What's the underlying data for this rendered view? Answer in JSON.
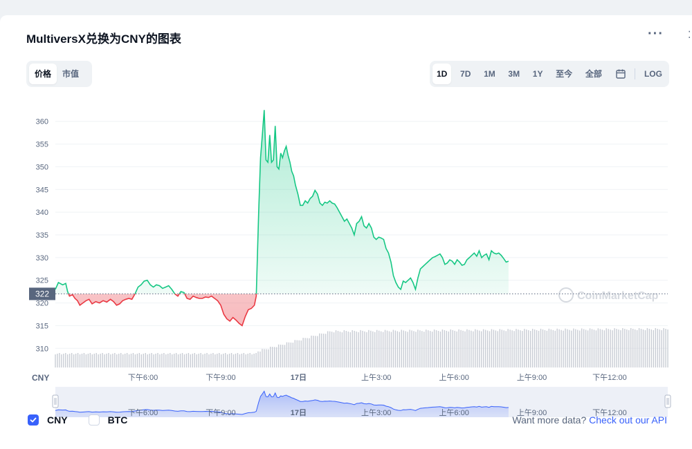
{
  "title": "MultiversX兑换为CNY的图表",
  "menu_icon": "more-dots-icon",
  "view_toggle": [
    "价格",
    "市值"
  ],
  "view_active": 0,
  "ranges": [
    "1D",
    "7D",
    "1M",
    "3M",
    "1Y",
    "至今",
    "全部"
  ],
  "range_active": 0,
  "calendar_icon": "calendar-icon",
  "log_label": "LOG",
  "legend": {
    "cny": "CNY",
    "btc": "BTC"
  },
  "api": {
    "prefix": "Want more data?",
    "link": "Check out our API"
  },
  "watermark": "CoinMarketCap",
  "colors": {
    "up": "#16c784",
    "down": "#ea3943",
    "accent": "#3861fb",
    "grid": "#eff2f5",
    "axis_text": "#58667e"
  },
  "chart_data": {
    "type": "line",
    "currency_label": "CNY",
    "baseline": 322,
    "ylim": [
      307,
      363
    ],
    "yticks": [
      310,
      315,
      320,
      325,
      330,
      335,
      340,
      345,
      350,
      355,
      360
    ],
    "x_ticks": [
      {
        "label": "下午6:00",
        "t": 0.143
      },
      {
        "label": "下午9:00",
        "t": 0.27
      },
      {
        "label": "17日",
        "t": 0.397
      },
      {
        "label": "上午3:00",
        "t": 0.524
      },
      {
        "label": "上午6:00",
        "t": 0.651
      },
      {
        "label": "上午9:00",
        "t": 0.778
      },
      {
        "label": "下午12:00",
        "t": 0.905
      }
    ],
    "series": [
      {
        "points": [
          [
            0.0,
            323.0
          ],
          [
            0.005,
            324.5
          ],
          [
            0.012,
            324.0
          ],
          [
            0.017,
            324.3
          ],
          [
            0.02,
            322.5
          ],
          [
            0.023,
            321.5
          ],
          [
            0.028,
            321.8
          ],
          [
            0.032,
            321.0
          ],
          [
            0.036,
            320.5
          ],
          [
            0.04,
            319.5
          ],
          [
            0.045,
            320.0
          ],
          [
            0.05,
            320.5
          ],
          [
            0.055,
            320.8
          ],
          [
            0.06,
            319.8
          ],
          [
            0.066,
            320.3
          ],
          [
            0.072,
            320.0
          ],
          [
            0.078,
            320.5
          ],
          [
            0.084,
            320.2
          ],
          [
            0.09,
            320.8
          ],
          [
            0.095,
            320.3
          ],
          [
            0.1,
            319.5
          ],
          [
            0.105,
            319.8
          ],
          [
            0.11,
            320.5
          ],
          [
            0.115,
            320.8
          ],
          [
            0.12,
            321.0
          ],
          [
            0.125,
            320.8
          ],
          [
            0.13,
            322.0
          ],
          [
            0.135,
            323.5
          ],
          [
            0.14,
            324.0
          ],
          [
            0.145,
            324.8
          ],
          [
            0.15,
            325.0
          ],
          [
            0.155,
            324.0
          ],
          [
            0.16,
            323.5
          ],
          [
            0.165,
            324.0
          ],
          [
            0.17,
            323.8
          ],
          [
            0.175,
            323.2
          ],
          [
            0.18,
            323.5
          ],
          [
            0.185,
            323.8
          ],
          [
            0.19,
            323.0
          ],
          [
            0.195,
            322.0
          ],
          [
            0.2,
            321.5
          ],
          [
            0.205,
            322.5
          ],
          [
            0.21,
            322.3
          ],
          [
            0.215,
            321.0
          ],
          [
            0.22,
            320.8
          ],
          [
            0.225,
            321.5
          ],
          [
            0.23,
            321.2
          ],
          [
            0.235,
            321.0
          ],
          [
            0.24,
            321.0
          ],
          [
            0.245,
            321.3
          ],
          [
            0.25,
            321.2
          ],
          [
            0.255,
            321.5
          ],
          [
            0.26,
            321.0
          ],
          [
            0.265,
            320.5
          ],
          [
            0.27,
            319.5
          ],
          [
            0.275,
            317.5
          ],
          [
            0.28,
            316.5
          ],
          [
            0.285,
            316.0
          ],
          [
            0.29,
            316.8
          ],
          [
            0.295,
            316.2
          ],
          [
            0.3,
            315.5
          ],
          [
            0.305,
            315.0
          ],
          [
            0.31,
            317.0
          ],
          [
            0.315,
            318.5
          ],
          [
            0.32,
            318.8
          ],
          [
            0.325,
            319.5
          ],
          [
            0.328,
            321.5
          ],
          [
            0.332,
            340.0
          ],
          [
            0.335,
            352.0
          ],
          [
            0.338,
            357.0
          ],
          [
            0.341,
            362.5
          ],
          [
            0.344,
            351.5
          ],
          [
            0.347,
            351.0
          ],
          [
            0.35,
            357.0
          ],
          [
            0.353,
            351.0
          ],
          [
            0.356,
            351.5
          ],
          [
            0.359,
            359.0
          ],
          [
            0.362,
            350.0
          ],
          [
            0.365,
            349.5
          ],
          [
            0.368,
            353.0
          ],
          [
            0.371,
            352.0
          ],
          [
            0.374,
            353.5
          ],
          [
            0.377,
            354.5
          ],
          [
            0.38,
            352.5
          ],
          [
            0.383,
            351.0
          ],
          [
            0.386,
            349.0
          ],
          [
            0.389,
            348.0
          ],
          [
            0.392,
            346.0
          ],
          [
            0.396,
            344.0
          ],
          [
            0.4,
            341.5
          ],
          [
            0.404,
            341.5
          ],
          [
            0.408,
            342.5
          ],
          [
            0.412,
            342.0
          ],
          [
            0.416,
            343.0
          ],
          [
            0.42,
            343.5
          ],
          [
            0.424,
            344.8
          ],
          [
            0.428,
            344.0
          ],
          [
            0.432,
            342.0
          ],
          [
            0.436,
            341.5
          ],
          [
            0.44,
            342.2
          ],
          [
            0.444,
            342.0
          ],
          [
            0.448,
            342.5
          ],
          [
            0.452,
            342.0
          ],
          [
            0.456,
            341.8
          ],
          [
            0.46,
            341.0
          ],
          [
            0.464,
            340.0
          ],
          [
            0.468,
            339.0
          ],
          [
            0.472,
            338.0
          ],
          [
            0.476,
            338.5
          ],
          [
            0.48,
            337.5
          ],
          [
            0.484,
            336.5
          ],
          [
            0.488,
            335.0
          ],
          [
            0.492,
            337.5
          ],
          [
            0.496,
            338.0
          ],
          [
            0.5,
            339.0
          ],
          [
            0.504,
            337.0
          ],
          [
            0.508,
            336.5
          ],
          [
            0.512,
            337.5
          ],
          [
            0.516,
            336.5
          ],
          [
            0.52,
            334.5
          ],
          [
            0.524,
            334.0
          ],
          [
            0.528,
            334.5
          ],
          [
            0.532,
            334.3
          ],
          [
            0.536,
            334.0
          ],
          [
            0.54,
            332.0
          ],
          [
            0.544,
            331.0
          ],
          [
            0.548,
            329.0
          ],
          [
            0.552,
            326.0
          ],
          [
            0.556,
            324.5
          ],
          [
            0.56,
            323.5
          ],
          [
            0.564,
            323.0
          ],
          [
            0.568,
            324.8
          ],
          [
            0.572,
            324.5
          ],
          [
            0.576,
            325.0
          ],
          [
            0.58,
            325.5
          ],
          [
            0.584,
            324.5
          ],
          [
            0.588,
            323.0
          ],
          [
            0.592,
            325.5
          ],
          [
            0.596,
            327.5
          ],
          [
            0.6,
            328.0
          ],
          [
            0.604,
            328.5
          ],
          [
            0.608,
            329.0
          ],
          [
            0.612,
            329.5
          ],
          [
            0.616,
            330.0
          ],
          [
            0.62,
            330.2
          ],
          [
            0.624,
            330.5
          ],
          [
            0.628,
            330.8
          ],
          [
            0.632,
            330.0
          ],
          [
            0.636,
            328.5
          ],
          [
            0.64,
            328.8
          ],
          [
            0.644,
            329.5
          ],
          [
            0.648,
            329.2
          ],
          [
            0.652,
            328.5
          ],
          [
            0.656,
            329.5
          ],
          [
            0.66,
            329.0
          ],
          [
            0.664,
            328.3
          ],
          [
            0.668,
            328.5
          ],
          [
            0.672,
            329.5
          ],
          [
            0.676,
            330.0
          ],
          [
            0.68,
            330.5
          ],
          [
            0.684,
            331.0
          ],
          [
            0.688,
            330.3
          ],
          [
            0.692,
            331.5
          ],
          [
            0.696,
            330.0
          ],
          [
            0.7,
            330.5
          ],
          [
            0.704,
            330.8
          ],
          [
            0.708,
            329.5
          ],
          [
            0.712,
            331.5
          ],
          [
            0.716,
            331.0
          ],
          [
            0.72,
            330.8
          ],
          [
            0.724,
            331.0
          ],
          [
            0.728,
            330.5
          ],
          [
            0.732,
            329.8
          ],
          [
            0.736,
            329.0
          ],
          [
            0.74,
            329.2
          ]
        ],
        "volume_start": 0.33
      }
    ]
  }
}
